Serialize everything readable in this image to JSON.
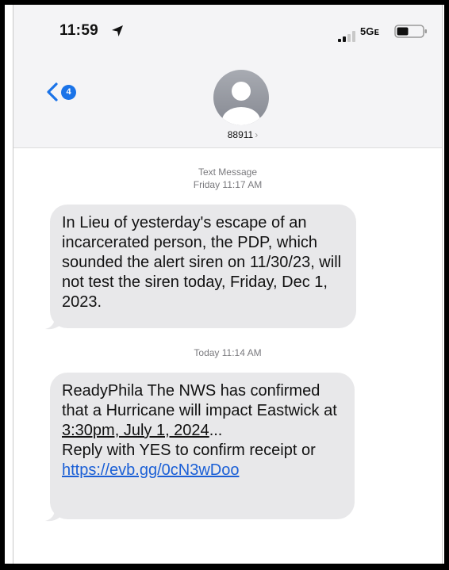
{
  "status": {
    "time": "11:59",
    "network": "5Gᴇ"
  },
  "nav": {
    "back_badge": "4",
    "contact": "88911",
    "contact_chevron": "›"
  },
  "messages": [
    {
      "meta_line1": "Text Message",
      "meta_line2": "Friday 11:17 AM",
      "text": "In Lieu of yesterday's escape of an incarcerated person, the PDP, which sounded the alert siren on 11/30/23, will not test the siren today, Friday, Dec 1, 2023."
    },
    {
      "meta_line1": "Today 11:14 AM",
      "text_part1": "ReadyPhila The NWS has confirmed that a Hurricane will impact Eastwick at ",
      "text_underlined": "3:30pm, July 1, 2024",
      "text_part2": "...",
      "text_part3": "Reply with YES to confirm receipt or ",
      "link": "https://evb.gg/0cN3wDoo"
    }
  ],
  "colors": {
    "accent": "#1a73e8",
    "bubble": "#e8e8ea",
    "header": "#f4f4f6",
    "link": "#1a5fd6"
  },
  "icons": [
    "location-arrow-icon",
    "signal-bars-icon",
    "battery-icon",
    "back-chevron-icon",
    "contact-avatar-icon"
  ]
}
